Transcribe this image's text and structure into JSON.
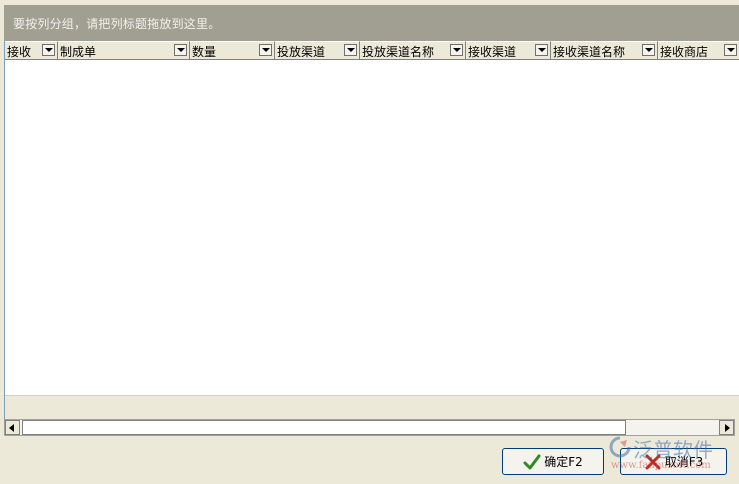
{
  "group_panel": {
    "hint": "要按列分组，请把列标题拖放到这里。"
  },
  "columns": [
    {
      "label": "接收"
    },
    {
      "label": "制成单"
    },
    {
      "label": "数量"
    },
    {
      "label": "投放渠道"
    },
    {
      "label": "投放渠道名称"
    },
    {
      "label": "接收渠道"
    },
    {
      "label": "接收渠道名称"
    },
    {
      "label": "接收商店"
    }
  ],
  "buttons": {
    "ok_label": "确定F2",
    "cancel_label": "取消F3"
  },
  "icons": {
    "ok": "check-icon",
    "cancel": "x-icon",
    "dropdown": "dropdown-arrow-icon",
    "scroll_left": "arrow-left-icon",
    "scroll_right": "arrow-right-icon"
  },
  "watermark": {
    "brand": "泛普软件",
    "url": "www.fanpusoft.com"
  },
  "colors": {
    "group_panel_bg": "#a09f92",
    "window_bg": "#ece9d8",
    "ok_check": "#2e8b22",
    "cancel_x": "#c0261c"
  }
}
